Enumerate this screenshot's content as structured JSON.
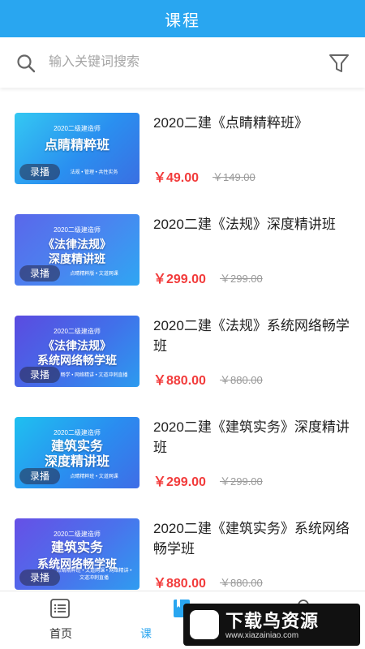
{
  "header": {
    "title": "课程"
  },
  "search": {
    "placeholder": "输入关键词搜索"
  },
  "courses": [
    {
      "title": "2020二建《点睛精粹班》",
      "price": "￥49.00",
      "original_price": "￥149.00",
      "thumb": {
        "subtitle": "2020二级建造师",
        "main": [
          "点睛精粹班"
        ],
        "tagline": "法规 • 管理 • 共性实务",
        "badge": "录播"
      }
    },
    {
      "title": "2020二建《法规》深度精讲班",
      "price": "￥299.00",
      "original_price": "￥299.00",
      "thumb": {
        "subtitle": "2020二级建造师",
        "main": [
          "《法律法规》",
          "深度精讲班"
        ],
        "tagline": "点睛精粹版 • 文道网课",
        "badge": "录播"
      }
    },
    {
      "title": "2020二建《法规》系统网络畅学班",
      "price": "￥880.00",
      "original_price": "￥880.00",
      "thumb": {
        "subtitle": "2020二级建造师",
        "main": [
          "《法律法规》",
          "系统网络畅学班"
        ],
        "tagline": "畅学 • 网络精讲 • 文道冲刺直播",
        "badge": "录播"
      }
    },
    {
      "title": "2020二建《建筑实务》深度精讲班",
      "price": "￥299.00",
      "original_price": "￥299.00",
      "thumb": {
        "subtitle": "2020二级建造师",
        "main": [
          "建筑实务",
          "深度精讲班"
        ],
        "tagline": "点睛精粹班 • 文道网课",
        "badge": "录播"
      }
    },
    {
      "title": "2020二建《建筑实务》系统网络畅学班",
      "price": "￥880.00",
      "original_price": "￥880.00",
      "thumb": {
        "subtitle": "2020二级建造师",
        "main": [
          "建筑实务",
          "系统网络畅学班"
        ],
        "tagline": "点睛精粹班 • 文道网课 • 网络精讲 • 文道冲刺直播",
        "badge": "录播"
      }
    }
  ],
  "tabs": [
    {
      "label": "首页",
      "icon": "home-list-icon"
    },
    {
      "label": "课",
      "icon": "course-book-icon",
      "active": true
    },
    {
      "label": "",
      "icon": "user-icon"
    }
  ],
  "watermark": {
    "text": "下载鸟资源",
    "url": "www.xiazainiao.com"
  },
  "colors": {
    "primary": "#29a6f0",
    "price": "#f23b3b",
    "muted": "#999999"
  }
}
